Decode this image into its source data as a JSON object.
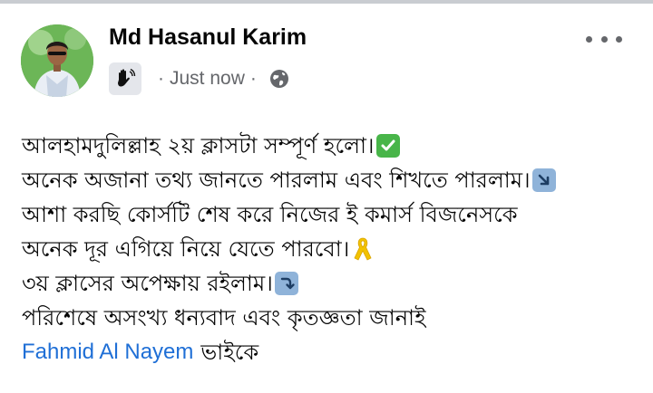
{
  "post": {
    "author": "Md Hasanul Karim",
    "timestamp": "Just now",
    "separator": "·",
    "badge_icon": "waving-hand-icon",
    "privacy_icon": "globe-icon",
    "more_icon": "more-options-icon",
    "lines": [
      {
        "text": "আলহামদুলিল্লাহ ২য় ক্লাসটা সম্পূর্ণ হলো।",
        "emoji": "check-mark-icon"
      },
      {
        "text": "অনেক অজানা তথ্য জানতে পারলাম এবং শিখতে পারলাম।",
        "emoji": "arrow-down-right-icon"
      },
      {
        "text": "আশা করছি কোর্সটি শেষ করে নিজের ই কমার্স বিজনেসকে",
        "emoji": ""
      },
      {
        "text": "অনেক দূর এগিয়ে নিয়ে যেতে পারবো।",
        "emoji": "ribbon-icon"
      },
      {
        "text": "৩য় ক্লাসের অপেক্ষায় রইলাম।",
        "emoji": "arrow-curve-down-icon"
      },
      {
        "text": "পরিশেষে অসংখ্য ধন্যবাদ এবং কৃতজ্ঞতা জানাই",
        "emoji": ""
      }
    ],
    "mention": "Fahmid Al Nayem",
    "mention_suffix": "ভাইকে"
  },
  "colors": {
    "link": "#1f6fd6",
    "meta": "#65676b",
    "text": "#050505"
  }
}
